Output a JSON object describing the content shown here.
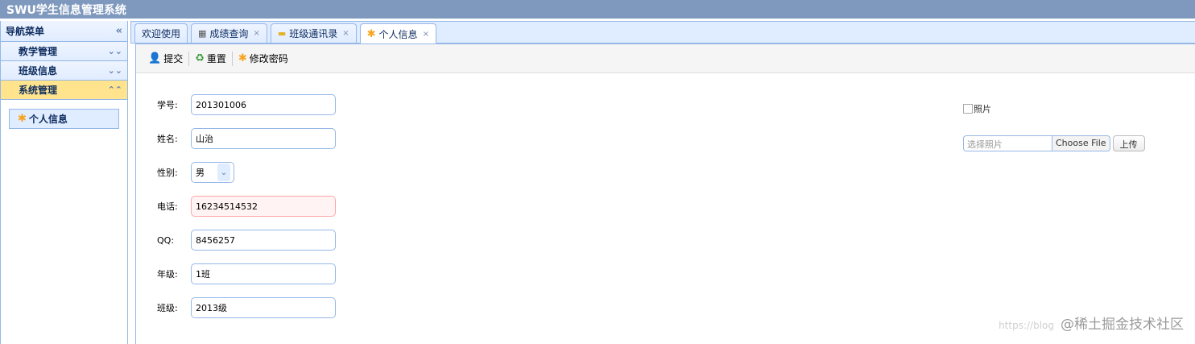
{
  "app": {
    "title": "SWU学生信息管理系统"
  },
  "nav": {
    "header": "导航菜单",
    "collapse_icon": "double-chevron-left-icon",
    "sections": [
      {
        "label": "教学管理",
        "expanded": false
      },
      {
        "label": "班级信息",
        "expanded": false
      },
      {
        "label": "系统管理",
        "expanded": true,
        "selected": true
      }
    ],
    "items": [
      {
        "label": "个人信息",
        "icon": "puzzle-icon"
      }
    ]
  },
  "tabs": [
    {
      "label": "欢迎使用",
      "closable": false,
      "active": false
    },
    {
      "label": "成绩查询",
      "icon": "table-icon",
      "closable": true,
      "active": false
    },
    {
      "label": "班级通讯录",
      "icon": "folder-icon",
      "closable": true,
      "active": false
    },
    {
      "label": "个人信息",
      "icon": "puzzle-icon",
      "closable": true,
      "active": true
    }
  ],
  "toolbar": {
    "submit_label": "提交",
    "reset_label": "重置",
    "password_label": "修改密码"
  },
  "form": {
    "student_id": {
      "label": "学号:",
      "value": "201301006"
    },
    "name": {
      "label": "姓名:",
      "value": "山治"
    },
    "gender": {
      "label": "性别:",
      "value": "男"
    },
    "phone": {
      "label": "电话:",
      "value": "16234514532"
    },
    "qq": {
      "label": "QQ:",
      "value": "8456257"
    },
    "grade": {
      "label": "年级:",
      "value": "1班"
    },
    "class": {
      "label": "班级:",
      "value": "2013级"
    }
  },
  "photo": {
    "alt": "照片",
    "upload_placeholder": "选择照片",
    "choose_label": "Choose File",
    "upload_label": "上传"
  },
  "watermark": {
    "url": "https://blog",
    "site": "@稀土掘金技术社区"
  },
  "colors": {
    "topbar": "#7f99be",
    "accent_border": "#95b8e7",
    "selected_section": "#ffe48d",
    "error_field": "#fff3f3"
  }
}
